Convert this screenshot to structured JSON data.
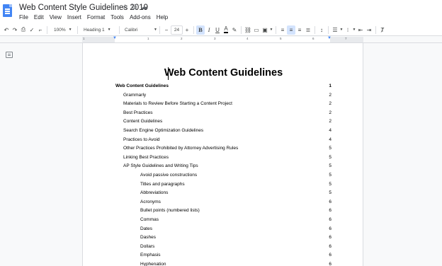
{
  "document": {
    "title": "Web Content Style Guidelines 2019"
  },
  "title_icons": [
    "star-icon",
    "move-to-folder-icon",
    "cloud-saved-icon"
  ],
  "menu": [
    "File",
    "Edit",
    "View",
    "Insert",
    "Format",
    "Tools",
    "Add-ons",
    "Help"
  ],
  "toolbar": {
    "zoom": "100%",
    "style": "Heading 1",
    "font": "Calibri",
    "font_size": "24",
    "bold": "B",
    "italic": "I",
    "underline": "U",
    "text_color": "A"
  },
  "ruler": {
    "numbers": [
      "1",
      "1",
      "2",
      "3",
      "4",
      "5",
      "6",
      "7"
    ]
  },
  "page": {
    "heading": "Web Content Guidelines",
    "toc": [
      {
        "text": "Web Content Guidelines",
        "page": "1",
        "level": 0
      },
      {
        "text": "Grammarly",
        "page": "2",
        "level": 1
      },
      {
        "text": "Materials to Review Before Starting a Content Project",
        "page": "2",
        "level": 1
      },
      {
        "text": "Best Practices",
        "page": "2",
        "level": 1
      },
      {
        "text": "Content Guidelines",
        "page": "2",
        "level": 1
      },
      {
        "text": "Search Engine Optimization Guidelines",
        "page": "4",
        "level": 1
      },
      {
        "text": "Practices to Avoid",
        "page": "4",
        "level": 1
      },
      {
        "text": "Other Practices Prohibited by Attorney Advertising Rules",
        "page": "5",
        "level": 1
      },
      {
        "text": "Linking Best Practices",
        "page": "5",
        "level": 1
      },
      {
        "text": "AP Style Guidelines and Writing Tips",
        "page": "5",
        "level": 1
      },
      {
        "text": "Avoid passive constructions",
        "page": "5",
        "level": 2
      },
      {
        "text": "Titles and paragraphs",
        "page": "5",
        "level": 2
      },
      {
        "text": "Abbreviations",
        "page": "5",
        "level": 2
      },
      {
        "text": "Acronyms",
        "page": "6",
        "level": 2
      },
      {
        "text": "Bullet points (numbered lists)",
        "page": "6",
        "level": 2
      },
      {
        "text": "Commas",
        "page": "6",
        "level": 2
      },
      {
        "text": "Dates",
        "page": "6",
        "level": 2
      },
      {
        "text": "Dashes",
        "page": "6",
        "level": 2
      },
      {
        "text": "Dollars",
        "page": "6",
        "level": 2
      },
      {
        "text": "Emphasis",
        "page": "6",
        "level": 2
      },
      {
        "text": "Hyphenation",
        "page": "6",
        "level": 2
      }
    ]
  },
  "colors": {
    "accent": "#4285f4",
    "active_button": "#d3e3fd"
  }
}
